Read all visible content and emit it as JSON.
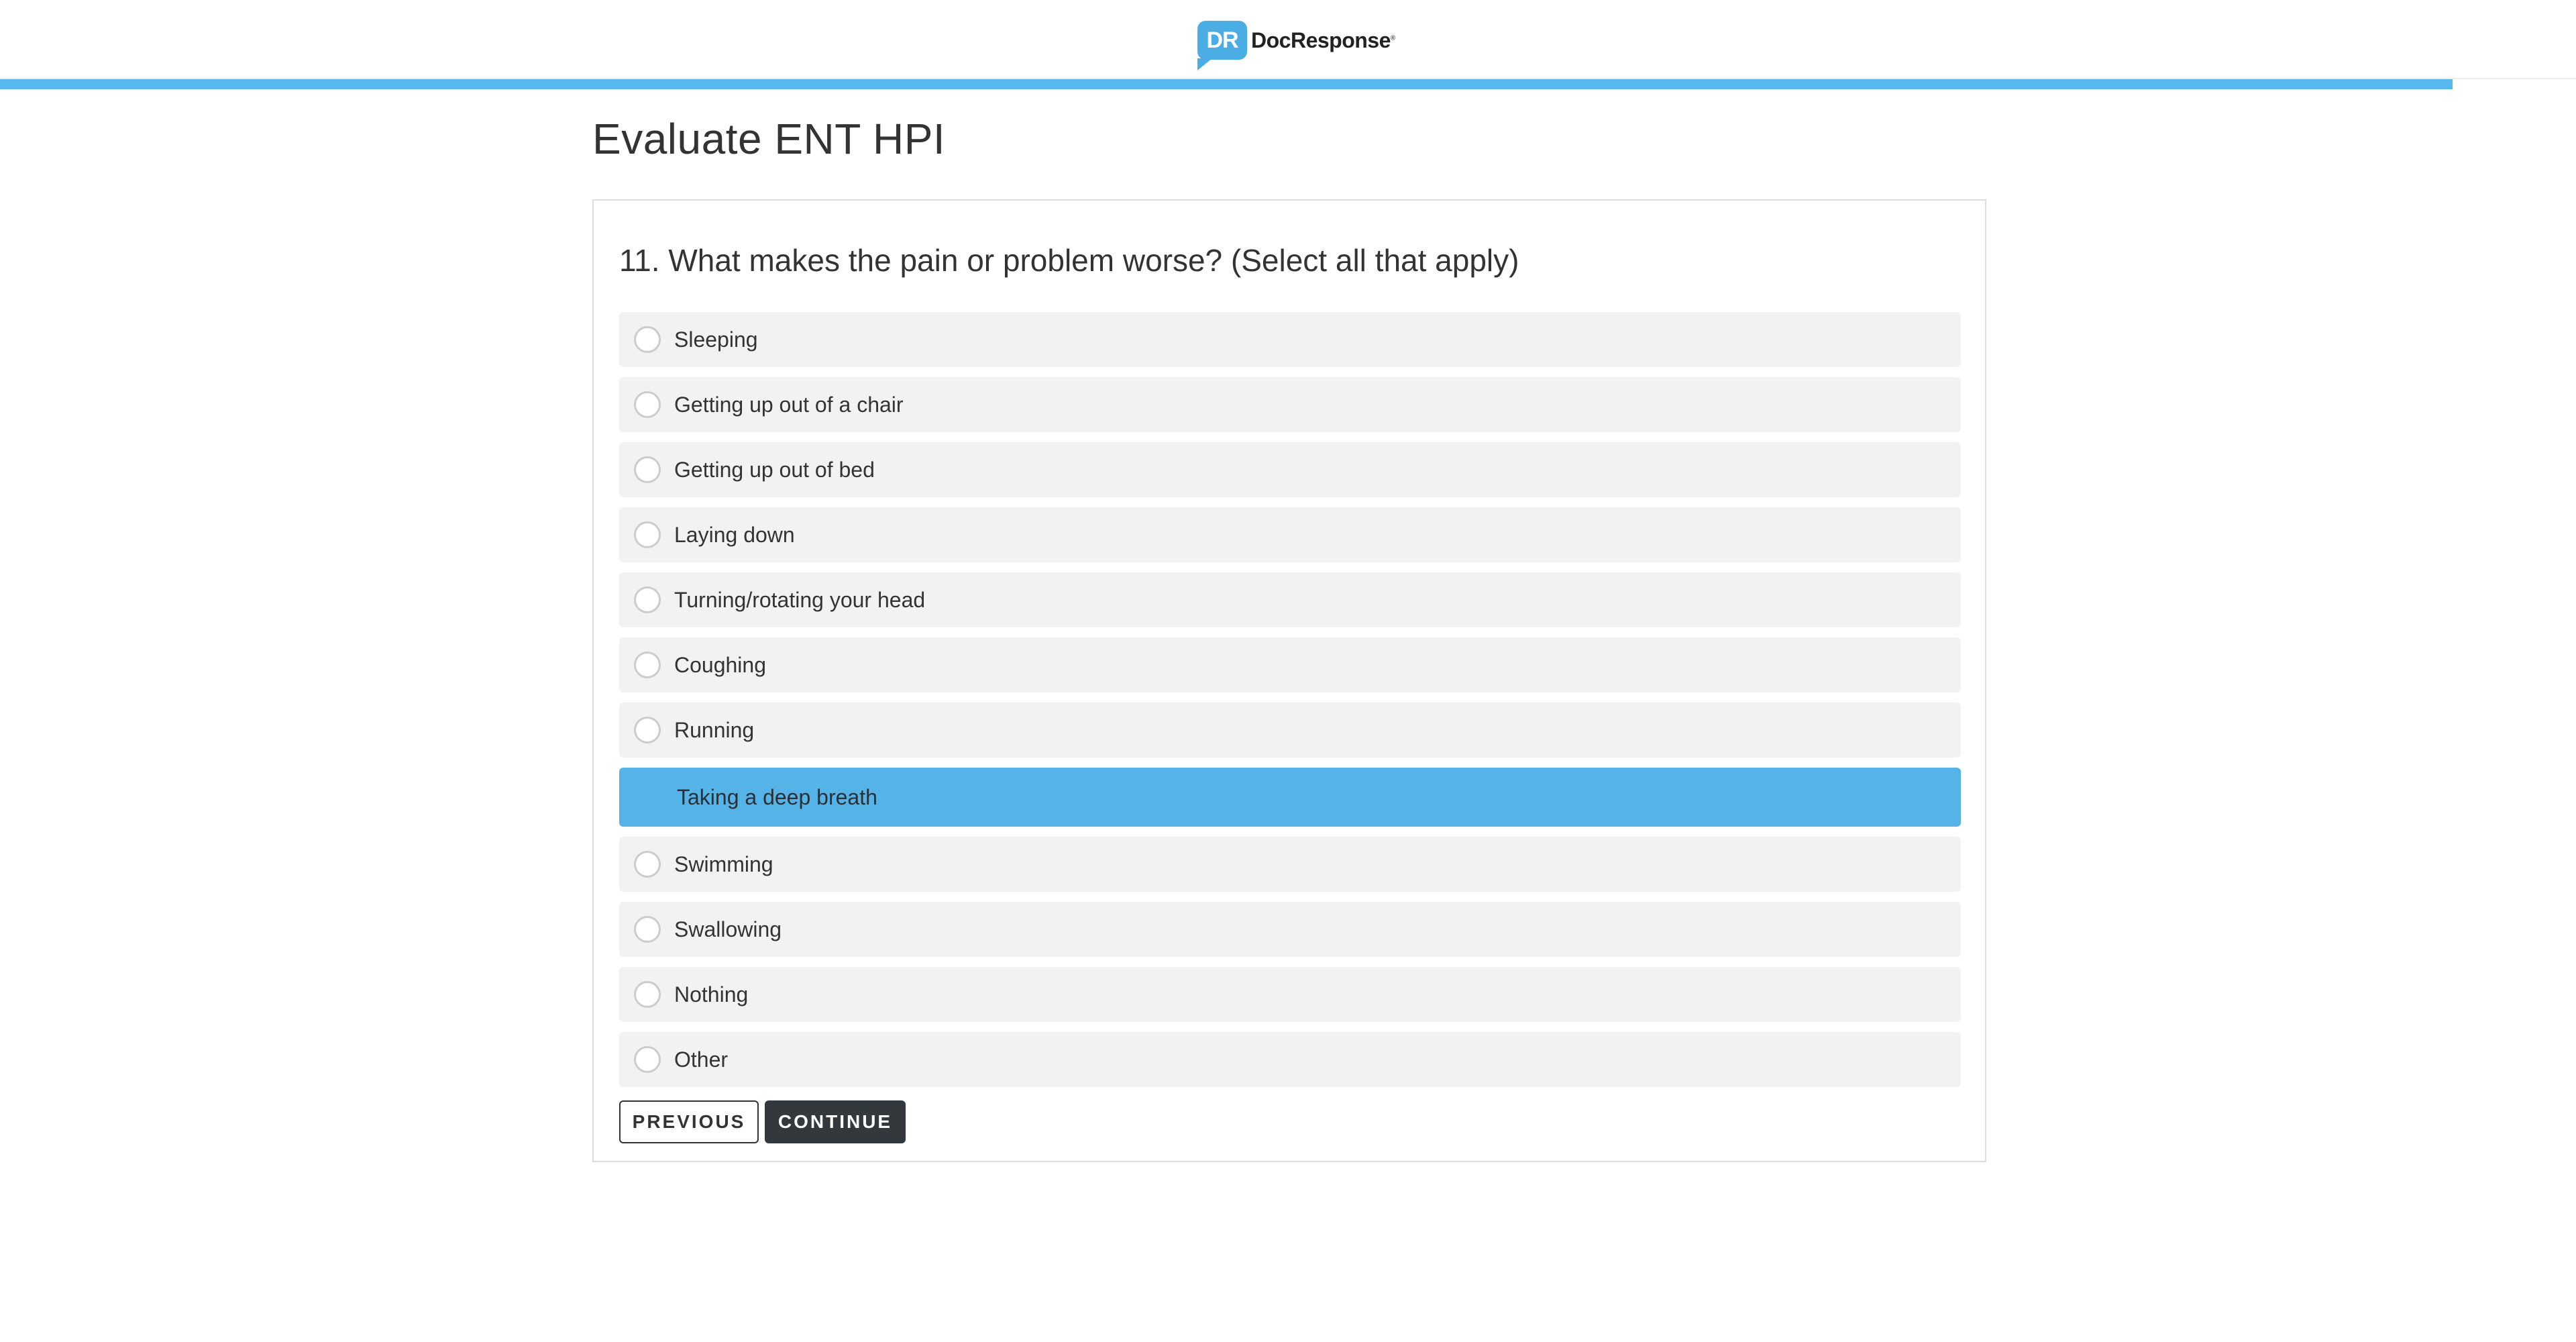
{
  "header": {
    "logo_badge": "DR",
    "logo_text": "DocResponse",
    "logo_mark": "®"
  },
  "progress": {
    "fraction": 0.952
  },
  "page_title": "Evaluate ENT HPI",
  "question": {
    "text": "11. What makes the pain or problem worse? (Select all that apply)",
    "options": [
      {
        "label": "Sleeping",
        "selected": false
      },
      {
        "label": "Getting up out of a chair",
        "selected": false
      },
      {
        "label": "Getting up out of bed",
        "selected": false
      },
      {
        "label": "Laying down",
        "selected": false
      },
      {
        "label": "Turning/rotating your head",
        "selected": false
      },
      {
        "label": "Coughing",
        "selected": false
      },
      {
        "label": "Running",
        "selected": false
      },
      {
        "label": "Taking a deep breath",
        "selected": true
      },
      {
        "label": "Swimming",
        "selected": false
      },
      {
        "label": "Swallowing",
        "selected": false
      },
      {
        "label": "Nothing",
        "selected": false
      },
      {
        "label": "Other",
        "selected": false
      }
    ]
  },
  "buttons": {
    "previous": "PREVIOUS",
    "continue": "CONTINUE"
  },
  "colors": {
    "accent": "#56b8ec",
    "selected_option": "#56b3e8",
    "option_bg": "#f2f2f2",
    "continue_bg": "#33383c"
  }
}
